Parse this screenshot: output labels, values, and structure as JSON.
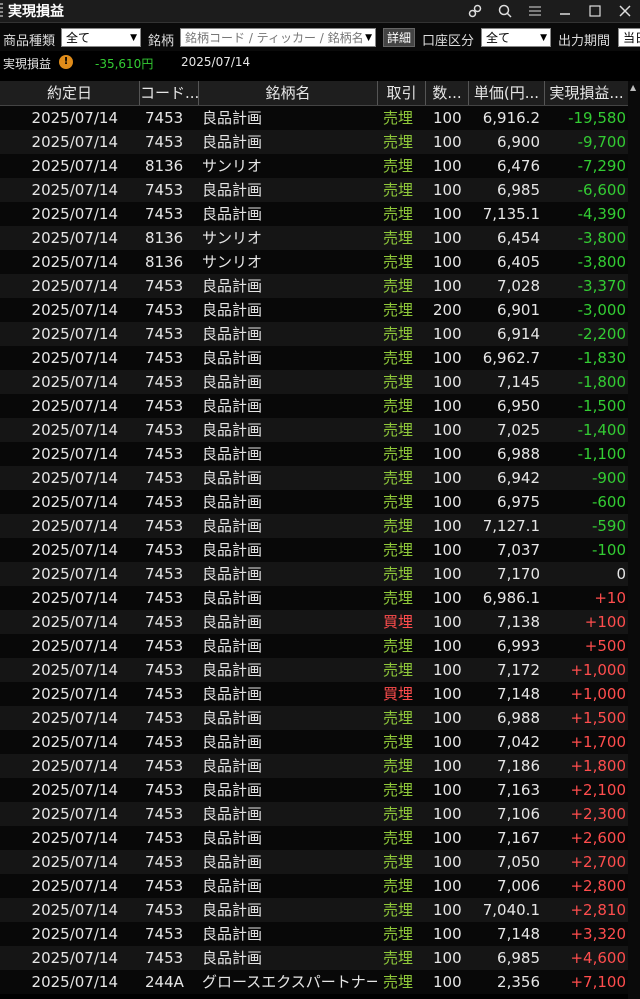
{
  "window": {
    "title": "実現損益"
  },
  "filters": {
    "product_label": "商品種類",
    "product_value": "全て",
    "symbol_label": "銘柄",
    "symbol_placeholder": "銘柄コード / ティッカー / 銘柄名",
    "detail_button": "詳細",
    "account_label": "口座区分",
    "account_value": "全て",
    "period_label": "出力期間",
    "period_value": "当日"
  },
  "summary": {
    "label": "実現損益",
    "value": "-35,610円",
    "date": "2025/07/14"
  },
  "table": {
    "headers": [
      "約定日",
      "コード...",
      "銘柄名",
      "取引",
      "数...",
      "単価(円...",
      "実現損益..."
    ],
    "rows": [
      [
        "2025/07/14",
        "7453",
        "良品計画",
        "売埋",
        "100",
        "6,916.2",
        "-19,580"
      ],
      [
        "2025/07/14",
        "7453",
        "良品計画",
        "売埋",
        "100",
        "6,900",
        "-9,700"
      ],
      [
        "2025/07/14",
        "8136",
        "サンリオ",
        "売埋",
        "100",
        "6,476",
        "-7,290"
      ],
      [
        "2025/07/14",
        "7453",
        "良品計画",
        "売埋",
        "100",
        "6,985",
        "-6,600"
      ],
      [
        "2025/07/14",
        "7453",
        "良品計画",
        "売埋",
        "100",
        "7,135.1",
        "-4,390"
      ],
      [
        "2025/07/14",
        "8136",
        "サンリオ",
        "売埋",
        "100",
        "6,454",
        "-3,800"
      ],
      [
        "2025/07/14",
        "8136",
        "サンリオ",
        "売埋",
        "100",
        "6,405",
        "-3,800"
      ],
      [
        "2025/07/14",
        "7453",
        "良品計画",
        "売埋",
        "100",
        "7,028",
        "-3,370"
      ],
      [
        "2025/07/14",
        "7453",
        "良品計画",
        "売埋",
        "200",
        "6,901",
        "-3,000"
      ],
      [
        "2025/07/14",
        "7453",
        "良品計画",
        "売埋",
        "100",
        "6,914",
        "-2,200"
      ],
      [
        "2025/07/14",
        "7453",
        "良品計画",
        "売埋",
        "100",
        "6,962.7",
        "-1,830"
      ],
      [
        "2025/07/14",
        "7453",
        "良品計画",
        "売埋",
        "100",
        "7,145",
        "-1,800"
      ],
      [
        "2025/07/14",
        "7453",
        "良品計画",
        "売埋",
        "100",
        "6,950",
        "-1,500"
      ],
      [
        "2025/07/14",
        "7453",
        "良品計画",
        "売埋",
        "100",
        "7,025",
        "-1,400"
      ],
      [
        "2025/07/14",
        "7453",
        "良品計画",
        "売埋",
        "100",
        "6,988",
        "-1,100"
      ],
      [
        "2025/07/14",
        "7453",
        "良品計画",
        "売埋",
        "100",
        "6,942",
        "-900"
      ],
      [
        "2025/07/14",
        "7453",
        "良品計画",
        "売埋",
        "100",
        "6,975",
        "-600"
      ],
      [
        "2025/07/14",
        "7453",
        "良品計画",
        "売埋",
        "100",
        "7,127.1",
        "-590"
      ],
      [
        "2025/07/14",
        "7453",
        "良品計画",
        "売埋",
        "100",
        "7,037",
        "-100"
      ],
      [
        "2025/07/14",
        "7453",
        "良品計画",
        "売埋",
        "100",
        "7,170",
        "0"
      ],
      [
        "2025/07/14",
        "7453",
        "良品計画",
        "売埋",
        "100",
        "6,986.1",
        "+10"
      ],
      [
        "2025/07/14",
        "7453",
        "良品計画",
        "買埋",
        "100",
        "7,138",
        "+100"
      ],
      [
        "2025/07/14",
        "7453",
        "良品計画",
        "売埋",
        "100",
        "6,993",
        "+500"
      ],
      [
        "2025/07/14",
        "7453",
        "良品計画",
        "売埋",
        "100",
        "7,172",
        "+1,000"
      ],
      [
        "2025/07/14",
        "7453",
        "良品計画",
        "買埋",
        "100",
        "7,148",
        "+1,000"
      ],
      [
        "2025/07/14",
        "7453",
        "良品計画",
        "売埋",
        "100",
        "6,988",
        "+1,500"
      ],
      [
        "2025/07/14",
        "7453",
        "良品計画",
        "売埋",
        "100",
        "7,042",
        "+1,700"
      ],
      [
        "2025/07/14",
        "7453",
        "良品計画",
        "売埋",
        "100",
        "7,186",
        "+1,800"
      ],
      [
        "2025/07/14",
        "7453",
        "良品計画",
        "売埋",
        "100",
        "7,163",
        "+2,100"
      ],
      [
        "2025/07/14",
        "7453",
        "良品計画",
        "売埋",
        "100",
        "7,106",
        "+2,300"
      ],
      [
        "2025/07/14",
        "7453",
        "良品計画",
        "売埋",
        "100",
        "7,167",
        "+2,600"
      ],
      [
        "2025/07/14",
        "7453",
        "良品計画",
        "売埋",
        "100",
        "7,050",
        "+2,700"
      ],
      [
        "2025/07/14",
        "7453",
        "良品計画",
        "売埋",
        "100",
        "7,006",
        "+2,800"
      ],
      [
        "2025/07/14",
        "7453",
        "良品計画",
        "売埋",
        "100",
        "7,040.1",
        "+2,810"
      ],
      [
        "2025/07/14",
        "7453",
        "良品計画",
        "売埋",
        "100",
        "7,148",
        "+3,320"
      ],
      [
        "2025/07/14",
        "7453",
        "良品計画",
        "売埋",
        "100",
        "6,985",
        "+4,600"
      ],
      [
        "2025/07/14",
        "244A",
        "グロースエクスパートナーズ",
        "売埋",
        "100",
        "2,356",
        "+7,100"
      ]
    ]
  },
  "colors": {
    "profit": "#ff4d4d",
    "loss": "#33cc33",
    "sell": "#8fc93a",
    "buy": "#ff4d4d"
  }
}
